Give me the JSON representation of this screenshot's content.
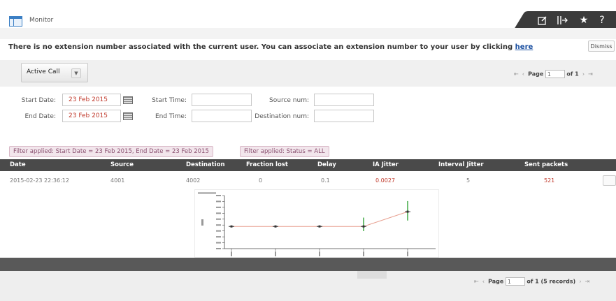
{
  "header": {
    "title": "Monitor",
    "icons": [
      "edit-icon",
      "column-icon",
      "star-icon",
      "help-icon"
    ]
  },
  "notice": {
    "text": "There is no extension number associated with the current user. You can associate an extension number to your user by clicking",
    "link_label": "here",
    "dismiss_label": "Dismiss"
  },
  "toolbar": {
    "view_select": "Active Call"
  },
  "pager_top": {
    "page_label": "Page",
    "page_value": "1",
    "of_label": "of 1"
  },
  "filters": {
    "start_date_label": "Start Date:",
    "start_date_value": "23 Feb 2015",
    "end_date_label": "End Date:",
    "end_date_value": "23 Feb 2015",
    "start_time_label": "Start Time:",
    "end_time_label": "End Time:",
    "source_num_label": "Source num:",
    "destination_num_label": "Destination num:",
    "start_time_value": "",
    "end_time_value": "",
    "source_num_value": "",
    "destination_num_value": ""
  },
  "applied_filters": [
    "Filter applied: Start Date = 23 Feb 2015, End Date = 23 Feb 2015",
    "Filter applied: Status = ALL"
  ],
  "table": {
    "columns": [
      "Date",
      "Source",
      "Destination",
      "Fraction lost",
      "Delay",
      "IA Jitter",
      "Interval Jitter",
      "Sent packets"
    ],
    "rows": [
      [
        "2015-02-23 22:36:12",
        "4001",
        "4002",
        "0",
        "0.1",
        "0.0027",
        "5",
        "521"
      ]
    ]
  },
  "colors": {
    "header_row": "#4a4a4a",
    "link": "#1a4fa0",
    "date_value": "#c0392b",
    "filter_chip": "#f2e6ec",
    "chart_line": "#e8a090",
    "chart_error_bar": "#4caf50"
  },
  "chart_data": {
    "type": "line",
    "x": [
      1,
      2,
      3,
      4,
      5
    ],
    "series": [
      {
        "values": [
          0.002,
          0.002,
          0.002,
          0.002,
          0.0045
        ]
      }
    ],
    "error_bars": [
      [
        0.002,
        0.002
      ],
      [
        0.002,
        0.002
      ],
      [
        0.002,
        0.002
      ],
      [
        0.0012,
        0.0035
      ],
      [
        0.003,
        0.0063
      ]
    ],
    "ylim": [
      -0.002,
      0.007
    ]
  },
  "pager_bottom": {
    "page_label": "Page",
    "page_value": "1",
    "of_label": "of 1 (5 records)"
  }
}
